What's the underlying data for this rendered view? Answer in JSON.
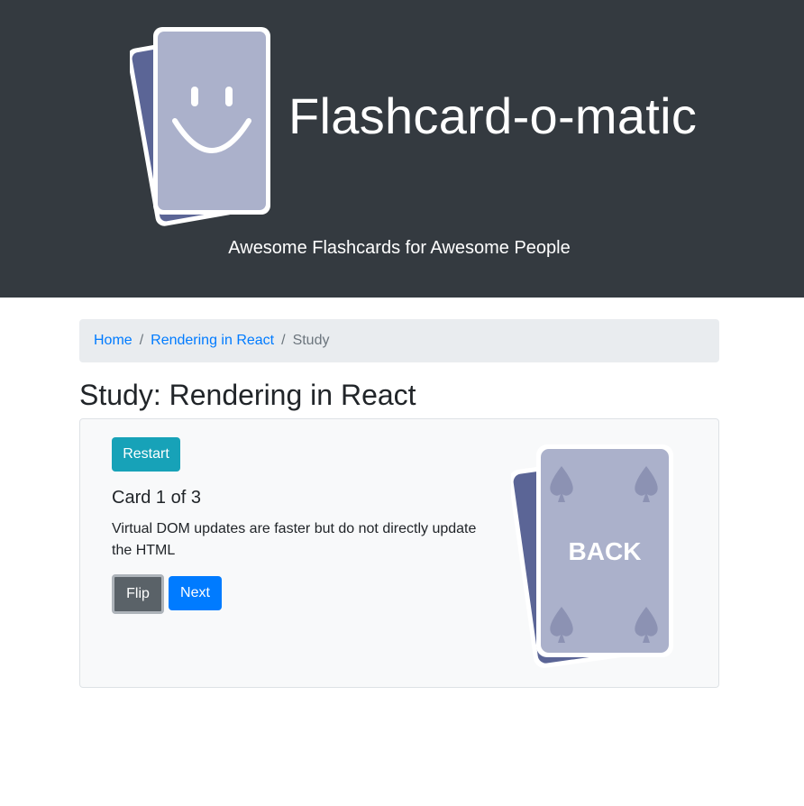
{
  "header": {
    "title": "Flashcard-o-matic",
    "tagline": "Awesome Flashcards for Awesome People",
    "logo_icon": "smiley-card-deck-icon"
  },
  "breadcrumb": {
    "home": "Home",
    "separator": "/",
    "deck": "Rendering in React",
    "current": "Study"
  },
  "page": {
    "title": "Study: Rendering in React"
  },
  "study": {
    "restart_label": "Restart",
    "card_counter": "Card 1 of 3",
    "card_text": "Virtual DOM updates are faster but do not directly update the HTML",
    "flip_label": "Flip",
    "next_label": "Next",
    "card_image_text": "BACK",
    "card_image_icon": "card-back-deck-icon"
  },
  "colors": {
    "header_bg": "#343a40",
    "card_face": "#abb1cb",
    "card_shadow": "#5b6596",
    "restart": "#17a2b8",
    "flip": "#5a6268",
    "next": "#007bff",
    "link": "#007bff"
  }
}
